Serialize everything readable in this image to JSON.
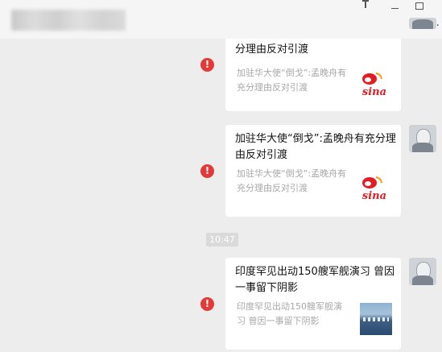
{
  "window": {
    "controls": [
      "pin-icon",
      "minimize-icon",
      "maximize-icon",
      "more-icon"
    ]
  },
  "messages": [
    {
      "title": "分理由反对引渡",
      "desc": "加驻华大使“倒戈”:孟晚舟有充分理由反对引渡",
      "thumb": "sina-logo",
      "status": "send-failed"
    },
    {
      "title": "加驻华大使“倒戈”:孟晚舟有充分理由反对引渡",
      "desc": "加驻华大使“倒戈”:孟晚舟有充分理由反对引渡",
      "thumb": "sina-logo",
      "status": "send-failed"
    },
    {
      "title": "印度罕见出动150艘军舰演习 曾因一事留下阴影",
      "desc": "印度罕见出动150艘军舰演习 曾因一事留下阴影",
      "thumb": "warship-photo",
      "status": "send-failed"
    }
  ],
  "timestamp": "10:47",
  "error_mark": "!",
  "sina_text": "sina",
  "colors": {
    "error": "#e23a3a",
    "background": "#ededed",
    "card": "#ffffff"
  }
}
